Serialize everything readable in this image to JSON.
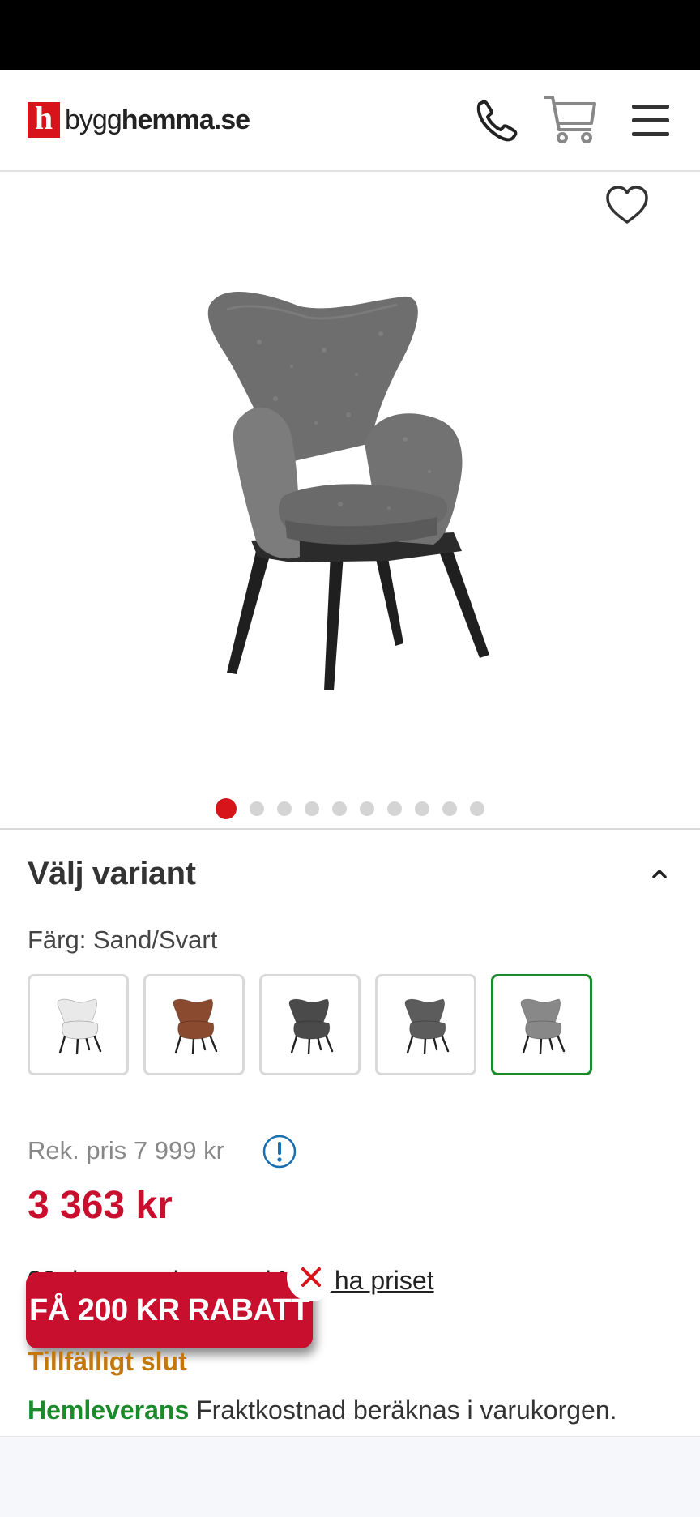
{
  "header": {
    "logo_letter": "h",
    "logo_prefix": "bygg",
    "logo_suffix": "hemma.se"
  },
  "gallery": {
    "image_count": 10,
    "active_index": 0
  },
  "variant": {
    "title": "Välj variant",
    "color_label": "Färg: Sand/Svart",
    "swatches": [
      {
        "color": "#e9e9e9",
        "leg": "#222"
      },
      {
        "color": "#8a4a30",
        "leg": "#222"
      },
      {
        "color": "#4a4a4a",
        "leg": "#222"
      },
      {
        "color": "#5c5c5c",
        "leg": "#222"
      },
      {
        "color": "#888888",
        "leg": "#222",
        "selected": true
      }
    ]
  },
  "pricing": {
    "recommended": "Rek. pris 7 999 kr",
    "price": "3 363 kr"
  },
  "match": {
    "prefix": "30 dagars prisgaranti ",
    "link": "Matcha priset"
  },
  "promo": {
    "label": "FÅ 200 KR RABATT"
  },
  "stock": {
    "status": "Tillfälligt slut"
  },
  "delivery": {
    "label": "Hemleverans",
    "text": " Fraktkostnad beräknas i varukorgen."
  },
  "colors": {
    "brand": "#d7141a",
    "price": "#c8102e",
    "selected": "#1a8a2a",
    "stock_warning": "#c2780a",
    "info": "#1a6fb0"
  }
}
